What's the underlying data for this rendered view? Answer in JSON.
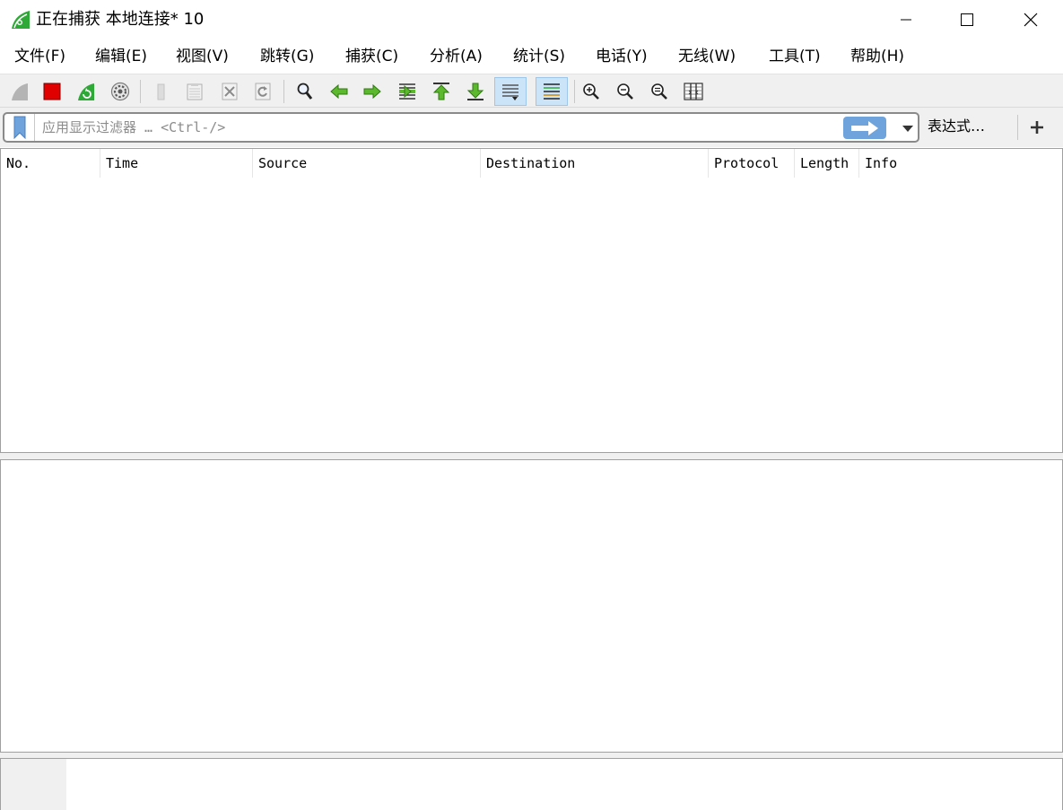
{
  "window": {
    "title": "正在捕获 本地连接* 10"
  },
  "menu": {
    "items": [
      {
        "label": "文件(F)",
        "name": "menu-file"
      },
      {
        "label": "编辑(E)",
        "name": "menu-edit"
      },
      {
        "label": "视图(V)",
        "name": "menu-view"
      },
      {
        "label": "跳转(G)",
        "name": "menu-go"
      },
      {
        "label": "捕获(C)",
        "name": "menu-capture"
      },
      {
        "label": "分析(A)",
        "name": "menu-analyze"
      },
      {
        "label": "统计(S)",
        "name": "menu-statistics"
      },
      {
        "label": "电话(Y)",
        "name": "menu-telephony"
      },
      {
        "label": "无线(W)",
        "name": "menu-wireless"
      },
      {
        "label": "工具(T)",
        "name": "menu-tools"
      },
      {
        "label": "帮助(H)",
        "name": "menu-help"
      }
    ]
  },
  "filter": {
    "placeholder": "应用显示过滤器 … <Ctrl-/>",
    "value": "",
    "expression_label": "表达式…",
    "add_label": "+"
  },
  "packet_list": {
    "columns": [
      "No.",
      "Time",
      "Source",
      "Destination",
      "Protocol",
      "Length",
      "Info"
    ]
  },
  "colors": {
    "accent_blue": "#6fa3dc",
    "stop_red": "#e00000",
    "shark_green": "#2ea836",
    "toolbar_bg": "#f0f0f0"
  }
}
